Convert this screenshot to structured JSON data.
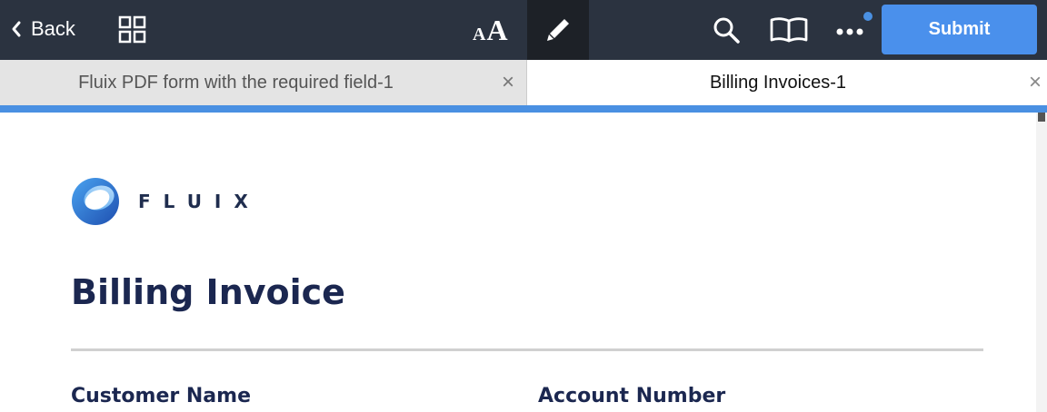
{
  "toolbar": {
    "back_label": "Back",
    "submit_label": "Submit",
    "font_small": "A",
    "font_big": "A",
    "accent_color": "#4a90ec",
    "background_color": "#2b3340",
    "icons": [
      "chevron-left-icon",
      "grid-icon",
      "text-size-icon",
      "pen-icon",
      "search-icon",
      "book-icon",
      "more-icon"
    ]
  },
  "tabs": [
    {
      "label": "Fluix PDF form with the required field-1",
      "active": false
    },
    {
      "label": "Billing Invoices-1",
      "active": true
    }
  ],
  "tab_close_symbol": "×",
  "document": {
    "logo_text": "FLUIX",
    "title": "Billing Invoice",
    "fields": [
      {
        "label": "Customer Name"
      },
      {
        "label": "Account Number"
      }
    ],
    "title_color": "#1b2750"
  }
}
